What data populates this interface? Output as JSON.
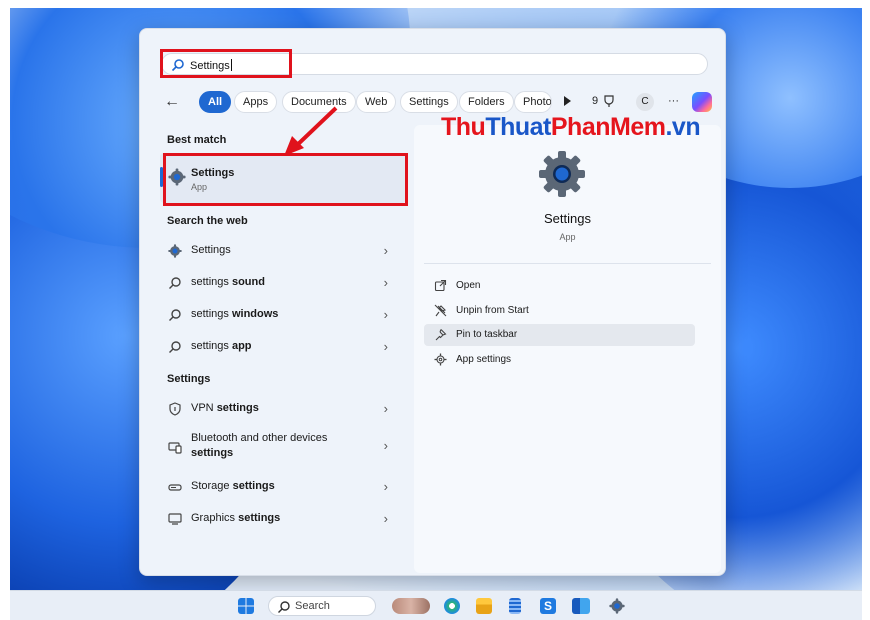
{
  "search": {
    "value": "Settings"
  },
  "filters": {
    "back": "←",
    "chips": [
      "All",
      "Apps",
      "Documents",
      "Web",
      "Settings",
      "Folders",
      "Photo"
    ],
    "count": "9",
    "avatar": "C",
    "more": "···"
  },
  "sections": {
    "best_match": "Best match",
    "search_web": "Search the web",
    "settings": "Settings"
  },
  "best_match": {
    "title": "Settings",
    "subtitle": "App"
  },
  "web_results": [
    {
      "icon": "gear-icon",
      "text": "Settings",
      "bold": ""
    },
    {
      "icon": "search-icon",
      "text": "settings ",
      "bold": "sound"
    },
    {
      "icon": "search-icon",
      "text": "settings ",
      "bold": "windows"
    },
    {
      "icon": "search-icon",
      "text": "settings ",
      "bold": "app"
    }
  ],
  "settings_results": [
    {
      "icon": "shield-icon",
      "text": "VPN ",
      "bold": "settings"
    },
    {
      "icon": "bluetooth-devices-icon",
      "text": "Bluetooth and other devices",
      "bold": "settings"
    },
    {
      "icon": "storage-icon",
      "text": "Storage ",
      "bold": "settings"
    },
    {
      "icon": "monitor-icon",
      "text": "Graphics ",
      "bold": "settings"
    }
  ],
  "chevron": "›",
  "preview": {
    "name": "Settings",
    "type": "App",
    "actions": [
      "Open",
      "Unpin from Start",
      "Pin to taskbar",
      "App settings"
    ]
  },
  "watermark": {
    "p1": "Thu",
    "p2": "Thuat",
    "p3": "PhanMem",
    "p4": ".vn"
  },
  "taskbar": {
    "search_label": "Search"
  },
  "colors": {
    "accent": "#1f68d1",
    "highlight_box": "#e0121c"
  }
}
